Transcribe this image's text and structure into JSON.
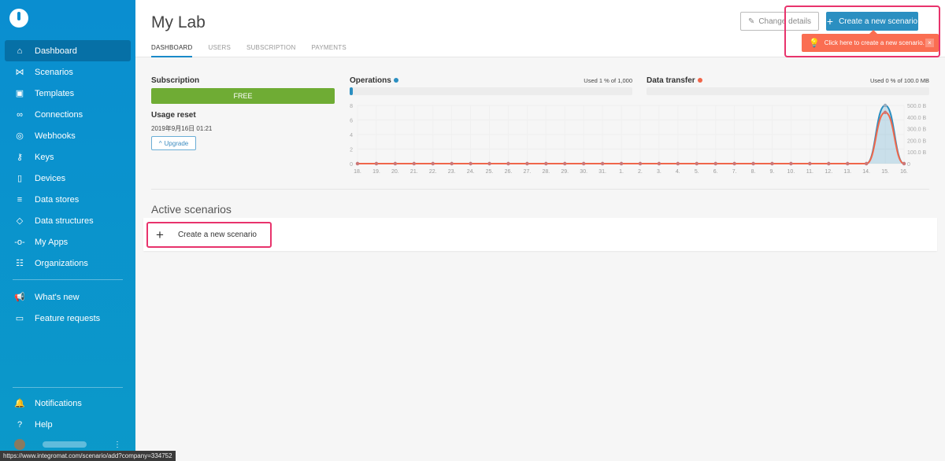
{
  "sidebar": {
    "items": [
      {
        "label": "Dashboard",
        "icon": "home-icon",
        "glyph": "⌂",
        "active": true
      },
      {
        "label": "Scenarios",
        "icon": "share-icon",
        "glyph": "⋈"
      },
      {
        "label": "Templates",
        "icon": "puzzle-icon",
        "glyph": "▣"
      },
      {
        "label": "Connections",
        "icon": "link-icon",
        "glyph": "∞"
      },
      {
        "label": "Webhooks",
        "icon": "globe-icon",
        "glyph": "◎"
      },
      {
        "label": "Keys",
        "icon": "key-icon",
        "glyph": "⚷"
      },
      {
        "label": "Devices",
        "icon": "mobile-icon",
        "glyph": "▯"
      },
      {
        "label": "Data stores",
        "icon": "database-icon",
        "glyph": "≡"
      },
      {
        "label": "Data structures",
        "icon": "cube-icon",
        "glyph": "◇"
      },
      {
        "label": "My Apps",
        "icon": "plug-icon",
        "glyph": "-o-"
      },
      {
        "label": "Organizations",
        "icon": "users-icon",
        "glyph": "☷"
      }
    ],
    "extra": [
      {
        "label": "What's new",
        "icon": "megaphone-icon",
        "glyph": "📢"
      },
      {
        "label": "Feature requests",
        "icon": "comment-icon",
        "glyph": "▭"
      }
    ],
    "bottom": [
      {
        "label": "Notifications",
        "icon": "bell-icon",
        "glyph": "🔔"
      },
      {
        "label": "Help",
        "icon": "question-icon",
        "glyph": "?"
      }
    ]
  },
  "status_url": "https://www.integromat.com/scenario/add?company=334752",
  "header": {
    "title": "My Lab",
    "tabs": [
      "DASHBOARD",
      "USERS",
      "SUBSCRIPTION",
      "PAYMENTS"
    ],
    "change_details": "Change details",
    "create_scenario": "Create a new scenario",
    "tooltip": "Click here to create a new scenario.",
    "tooltip_close": "×"
  },
  "subscription": {
    "label": "Subscription",
    "plan": "FREE",
    "usage_reset_label": "Usage reset",
    "usage_reset": "2019年9月16日 01:21",
    "upgrade": "Upgrade"
  },
  "operations": {
    "label": "Operations",
    "used": "Used 1 % of 1,000",
    "percent": 1,
    "color": "#2b8fc1"
  },
  "data_transfer": {
    "label": "Data transfer",
    "used": "Used 0 % of 100.0 MB",
    "percent": 0,
    "color": "#f0664a"
  },
  "chart_data": {
    "type": "line",
    "x": [
      "18.",
      "19.",
      "20.",
      "21.",
      "22.",
      "23.",
      "24.",
      "25.",
      "26.",
      "27.",
      "28.",
      "29.",
      "30.",
      "31.",
      "1.",
      "2.",
      "3.",
      "4.",
      "5.",
      "6.",
      "7.",
      "8.",
      "9.",
      "10.",
      "11.",
      "12.",
      "13.",
      "14.",
      "15.",
      "16."
    ],
    "y_left_ticks": [
      "0",
      "2",
      "4",
      "6",
      "8"
    ],
    "y_left_range": [
      0,
      8
    ],
    "y_right_ticks": [
      "0",
      "100.0 B",
      "200.0 B",
      "300.0 B",
      "400.0 B",
      "500.0 B"
    ],
    "y_right_range": [
      0,
      500
    ],
    "grid": true,
    "series": [
      {
        "name": "Operations",
        "axis": "left",
        "color": "#2b8fc1",
        "values": [
          0,
          0,
          0,
          0,
          0,
          0,
          0,
          0,
          0,
          0,
          0,
          0,
          0,
          0,
          0,
          0,
          0,
          0,
          0,
          0,
          0,
          0,
          0,
          0,
          0,
          0,
          0,
          0,
          8,
          0
        ]
      },
      {
        "name": "Data transfer",
        "axis": "right",
        "color": "#f0664a",
        "values": [
          0,
          0,
          0,
          0,
          0,
          0,
          0,
          0,
          0,
          0,
          0,
          0,
          0,
          0,
          0,
          0,
          0,
          0,
          0,
          0,
          0,
          0,
          0,
          0,
          0,
          0,
          0,
          0,
          440,
          0
        ]
      }
    ]
  },
  "active": {
    "title": "Active scenarios",
    "create": "Create a new scenario"
  }
}
